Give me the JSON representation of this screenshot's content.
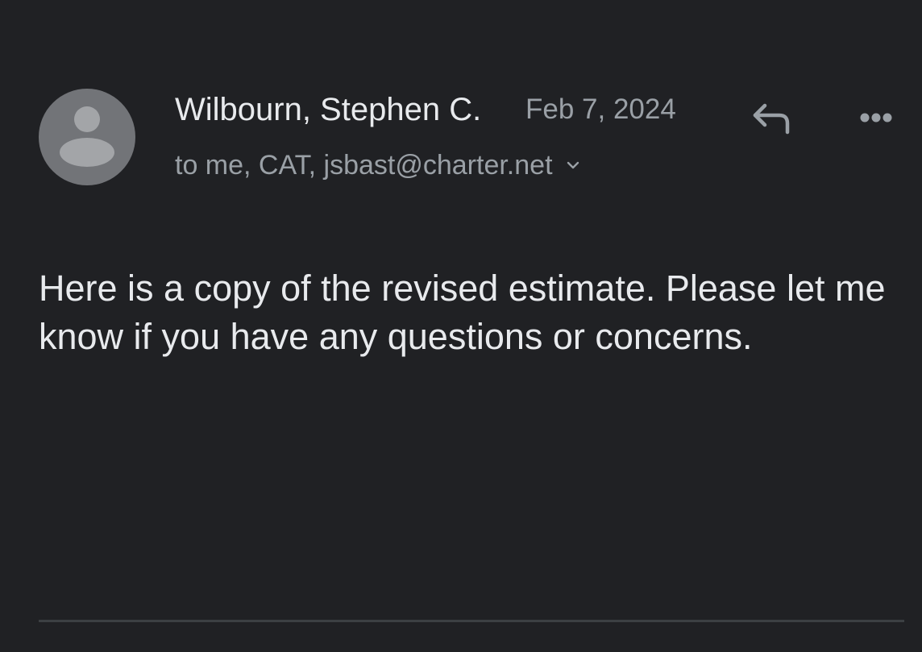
{
  "message": {
    "sender": {
      "name": "Wilbourn, Stephen C.",
      "avatar_icon": "person-icon",
      "avatar_color": "#727478"
    },
    "date": "Feb 7, 2024",
    "recipients": "to me, CAT, jsbast@charter.net",
    "body": "Here is a copy of the revised estimate. Please let me know if you have any questions or concerns."
  },
  "actions": {
    "reply_icon": "reply-icon",
    "more_icon": "more-options-icon",
    "expand_icon": "chevron-down-icon"
  },
  "colors": {
    "background": "#202124",
    "primary_text": "#e8eaed",
    "secondary_text": "#9aa0a6",
    "divider": "#3c4043"
  }
}
